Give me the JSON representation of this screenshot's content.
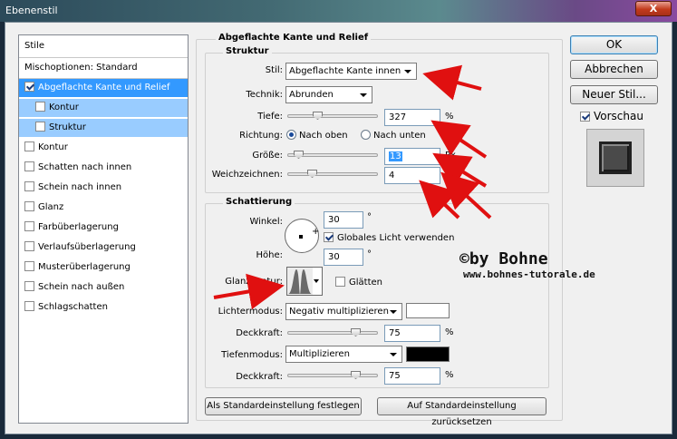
{
  "window": {
    "title": "Ebenenstil",
    "close": "X"
  },
  "sidebar": {
    "header": "Stile",
    "blend_options": "Mischoptionen: Standard",
    "items": [
      {
        "label": "Abgeflachte Kante und Relief",
        "checked": true,
        "selected": true
      },
      {
        "label": "Kontur",
        "checked": false,
        "sub": true
      },
      {
        "label": "Struktur",
        "checked": false,
        "sub": true
      },
      {
        "label": "Kontur",
        "checked": false
      },
      {
        "label": "Schatten nach innen",
        "checked": false
      },
      {
        "label": "Schein nach innen",
        "checked": false
      },
      {
        "label": "Glanz",
        "checked": false
      },
      {
        "label": "Farbüberlagerung",
        "checked": false
      },
      {
        "label": "Verlaufsüberlagerung",
        "checked": false
      },
      {
        "label": "Musterüberlagerung",
        "checked": false
      },
      {
        "label": "Schein nach außen",
        "checked": false
      },
      {
        "label": "Schlagschatten",
        "checked": false
      }
    ]
  },
  "main": {
    "section_title": "Abgeflachte Kante und Relief",
    "structure": {
      "title": "Struktur",
      "style_label": "Stil:",
      "style_value": "Abgeflachte Kante innen",
      "technique_label": "Technik:",
      "technique_value": "Abrunden",
      "depth_label": "Tiefe:",
      "depth_value": "327",
      "depth_unit": "%",
      "direction_label": "Richtung:",
      "direction_up": "Nach oben",
      "direction_down": "Nach unten",
      "size_label": "Größe:",
      "size_value": "13",
      "size_unit": "Px",
      "soften_label": "Weichzeichnen:",
      "soften_value": "4",
      "soften_unit": "Px"
    },
    "shading": {
      "title": "Schattierung",
      "angle_label": "Winkel:",
      "angle_value": "30",
      "angle_unit": "°",
      "global_light_label": "Globales Licht verwenden",
      "altitude_label": "Höhe:",
      "altitude_value": "30",
      "altitude_unit": "°",
      "gloss_label": "Glanzkontur:",
      "antialias_label": "Glätten",
      "highlight_mode_label": "Lichtermodus:",
      "highlight_mode_value": "Negativ multiplizieren",
      "highlight_color": "#ffffff",
      "highlight_opacity_label": "Deckkraft:",
      "highlight_opacity_value": "75",
      "highlight_opacity_unit": "%",
      "shadow_mode_label": "Tiefenmodus:",
      "shadow_mode_value": "Multiplizieren",
      "shadow_color": "#000000",
      "shadow_opacity_label": "Deckkraft:",
      "shadow_opacity_value": "75",
      "shadow_opacity_unit": "%"
    },
    "make_default": "Als Standardeinstellung festlegen",
    "reset_default": "Auf Standardeinstellung zurücksetzen"
  },
  "actions": {
    "ok": "OK",
    "cancel": "Abbrechen",
    "new_style": "Neuer Stil...",
    "preview": "Vorschau"
  },
  "watermark": {
    "line1": "©by Bohne",
    "line2": "www.bohnes-tutorale.de"
  },
  "colors": {
    "selected": "#3399ff",
    "sub_selected": "#99ccff",
    "arrow": "#e01010"
  }
}
